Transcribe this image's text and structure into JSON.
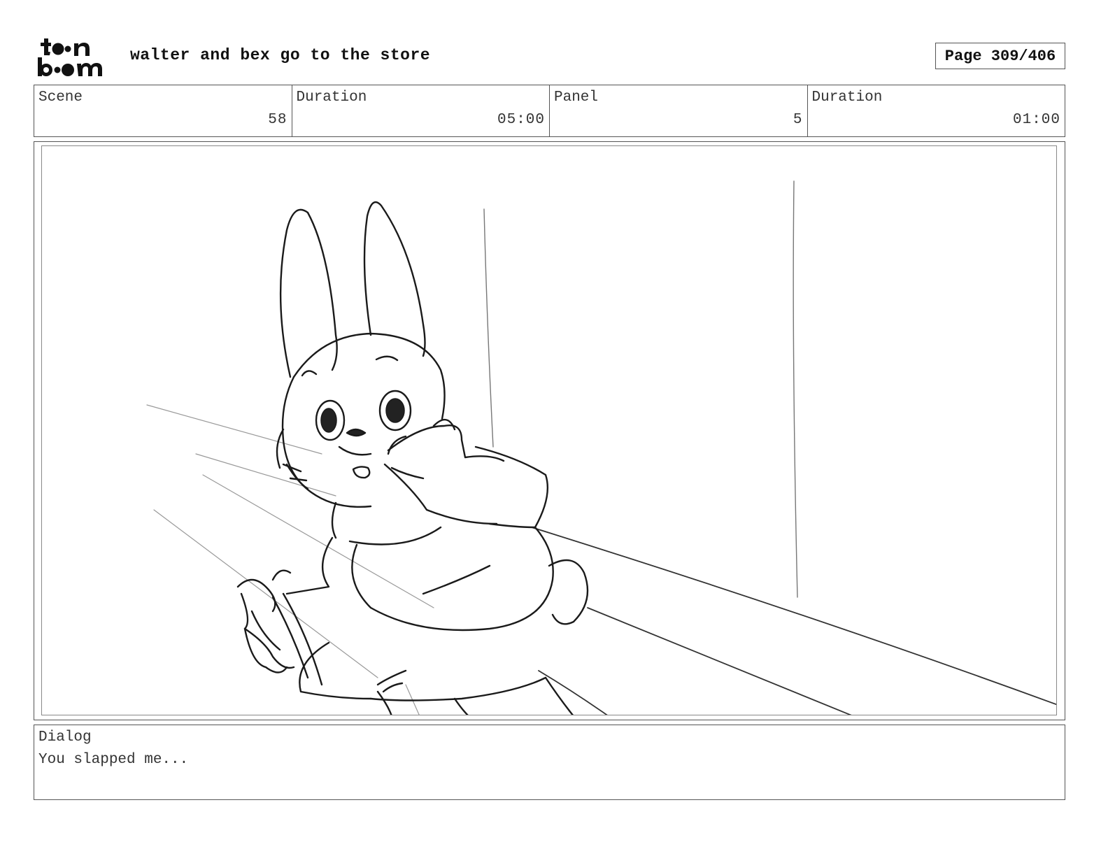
{
  "header": {
    "logo_text": "toon boom",
    "title": "walter and bex go to the store",
    "page": "Page 309/406"
  },
  "info": {
    "scene_label": "Scene",
    "scene_value": "58",
    "scene_duration_label": "Duration",
    "scene_duration_value": "05:00",
    "panel_label": "Panel",
    "panel_value": "5",
    "panel_duration_label": "Duration",
    "panel_duration_value": "01:00"
  },
  "panel": {
    "image_description": "rough pencil sketch of a rabbit holding its cheek"
  },
  "dialog": {
    "label": "Dialog",
    "text": "You slapped me..."
  }
}
